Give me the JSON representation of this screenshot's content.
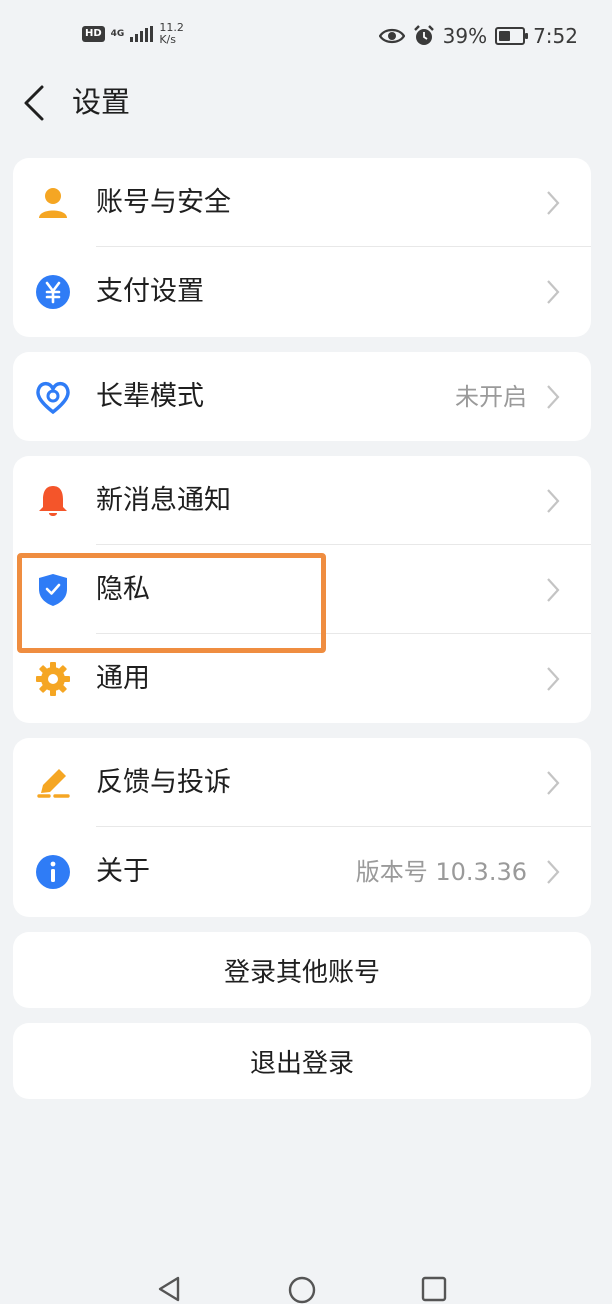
{
  "status_bar": {
    "hd": "HD",
    "network": "4G",
    "speed_value": "11.2",
    "speed_unit": "K/s",
    "battery": "39%",
    "time": "7:52"
  },
  "header": {
    "title": "设置"
  },
  "groups": [
    {
      "items": [
        {
          "label": "账号与安全",
          "value": "",
          "icon": "person-icon",
          "color": "#f5a623"
        },
        {
          "label": "支付设置",
          "value": "",
          "icon": "yuan-icon",
          "color": "#2f7cf6"
        }
      ]
    },
    {
      "items": [
        {
          "label": "长辈模式",
          "value": "未开启",
          "icon": "heart-hands-icon",
          "color": "#2f7cf6"
        }
      ]
    },
    {
      "items": [
        {
          "label": "新消息通知",
          "value": "",
          "icon": "bell-icon",
          "color": "#f4552a"
        },
        {
          "label": "隐私",
          "value": "",
          "icon": "shield-check-icon",
          "color": "#2f7cf6"
        },
        {
          "label": "通用",
          "value": "",
          "icon": "gear-icon",
          "color": "#f5a623"
        }
      ]
    },
    {
      "items": [
        {
          "label": "反馈与投诉",
          "value": "",
          "icon": "pencil-icon",
          "color": "#f5a623"
        },
        {
          "label": "关于",
          "value": "版本号 10.3.36",
          "icon": "info-icon",
          "color": "#2f7cf6"
        }
      ]
    }
  ],
  "buttons": {
    "switch_account": "登录其他账号",
    "logout": "退出登录"
  },
  "colors": {
    "highlight": "#ef8d40",
    "background": "#f1f3f5"
  }
}
